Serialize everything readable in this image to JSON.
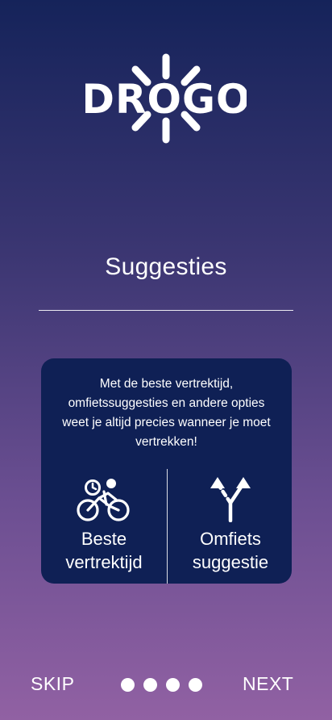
{
  "brand": {
    "logo_text": "DROGO",
    "logo_icon": "sun-logo-icon"
  },
  "slide": {
    "title": "Suggesties",
    "description": "Met de beste vertrektijd, omfietssuggesties en andere opties weet je altijd precies wanneer je moet vertrekken!",
    "features": [
      {
        "icon": "cyclist-clock-icon",
        "label_line1": "Beste",
        "label_line2": "vertrektijd"
      },
      {
        "icon": "fork-arrows-icon",
        "label_line1": "Omfiets",
        "label_line2": "suggestie"
      }
    ]
  },
  "navigation": {
    "skip_label": "SKIP",
    "next_label": "NEXT",
    "page_count": 4
  },
  "colors": {
    "card_background": "#0f2055",
    "gradient_top": "#15235a",
    "gradient_bottom": "#9161a3",
    "text": "#ffffff"
  }
}
